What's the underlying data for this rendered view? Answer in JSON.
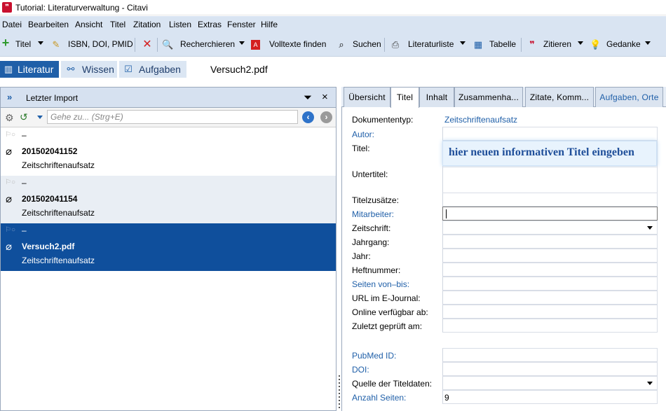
{
  "window": {
    "title": "Tutorial: Literaturverwaltung - Citavi"
  },
  "menu": [
    "Datei",
    "Bearbeiten",
    "Ansicht",
    "Titel",
    "Zitation",
    "Listen",
    "Extras",
    "Fenster",
    "Hilfe"
  ],
  "toolbar": {
    "titel": "Titel",
    "isbn": "ISBN, DOI, PMID",
    "recherchieren": "Recherchieren",
    "volltexte": "Volltexte finden",
    "suchen": "Suchen",
    "literaturliste": "Literaturliste",
    "tabelle": "Tabelle",
    "zitieren": "Zitieren",
    "gedanke": "Gedanke"
  },
  "nav": {
    "literatur": "Literatur",
    "wissen": "Wissen",
    "aufgaben": "Aufgaben",
    "document": "Versuch2.pdf"
  },
  "left_pane": {
    "header": "Letzter Import",
    "search_placeholder": "Gehe zu... (Strg+E)",
    "references": [
      {
        "marker": "–",
        "title": "201502041152",
        "type": "Zeitschriftenaufsatz"
      },
      {
        "marker": "–",
        "title": "201502041154",
        "type": "Zeitschriftenaufsatz"
      },
      {
        "marker": "–",
        "title": "Versuch2.pdf",
        "type": "Zeitschriftenaufsatz"
      }
    ]
  },
  "right_pane": {
    "tabs": [
      "Übersicht",
      "Titel",
      "Inhalt",
      "Zusammenha...",
      "Zitate,  Komm...",
      "Aufgaben, Orte"
    ],
    "fields": {
      "dokumenttyp": {
        "label": "Dokumententyp:",
        "value": "Zeitschriftenaufsatz"
      },
      "autor": "Autor:",
      "titel": "Titel:",
      "titel_hint": "hier neuen informativen Titel eingeben",
      "untertitel": "Untertitel:",
      "titelzusaetze": "Titelzusätze:",
      "mitarbeiter": "Mitarbeiter:",
      "zeitschrift": "Zeitschrift:",
      "jahrgang": "Jahrgang:",
      "jahr": "Jahr:",
      "heftnummer": "Heftnummer:",
      "seiten": "Seiten von–bis:",
      "url": "URL im E-Journal:",
      "online": "Online verfügbar ab:",
      "zuletzt": "Zuletzt geprüft am:",
      "pubmed": "PubMed ID:",
      "doi": "DOI:",
      "quelle": "Quelle der Titeldaten:",
      "anzahl": {
        "label": "Anzahl Seiten:",
        "value": "9"
      }
    }
  },
  "colors": {
    "accent": "#1f5fa8",
    "selection": "#0f4f9c",
    "menubar": "#d9e4f2"
  }
}
